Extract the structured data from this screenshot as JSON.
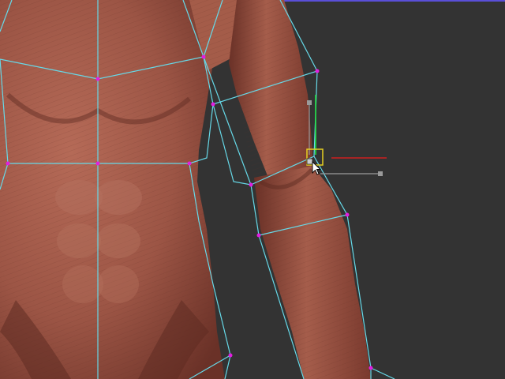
{
  "viewport": {
    "background_color": "#333333",
    "accent_strip_color": "#5a4fd8"
  },
  "model": {
    "description_icon": "muscle-anatomy-model",
    "skin_color": "#9c5545",
    "skin_shadow_color": "#5e2b22",
    "skin_highlight_color": "#c27a66"
  },
  "cage": {
    "line_color": "#66d9e8",
    "vertex_color": "#e21ee0"
  },
  "gizmo": {
    "x_axis_color": "#cc1f1f",
    "y_axis_color": "#22e044",
    "handle_color": "#e6d022",
    "secondary_axis_color": "#9a9a9a"
  },
  "cursor": {
    "icon": "arrow-cursor-icon"
  }
}
